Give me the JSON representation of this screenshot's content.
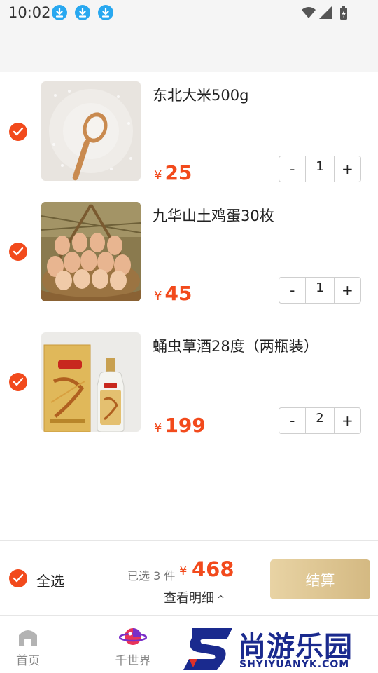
{
  "status_bar": {
    "time": "10:02",
    "notification_icons": [
      "download-icon",
      "download-icon",
      "download-icon"
    ],
    "system_icons": [
      "wifi-icon",
      "signal-icon",
      "battery-icon"
    ]
  },
  "cart": {
    "currency_symbol": "¥",
    "items": [
      {
        "name": "东北大米500g",
        "price": "25",
        "quantity": "1",
        "checked": true,
        "minus_label": "-",
        "plus_label": "+"
      },
      {
        "name": "九华山土鸡蛋30枚",
        "price": "45",
        "quantity": "1",
        "checked": true,
        "minus_label": "-",
        "plus_label": "+"
      },
      {
        "name": "蛹虫草酒28度（两瓶装）",
        "price": "199",
        "quantity": "2",
        "checked": true,
        "minus_label": "-",
        "plus_label": "+"
      }
    ]
  },
  "checkout": {
    "select_all_label": "全选",
    "selected_text": "已选 3 件",
    "currency_symbol": "¥",
    "total": "468",
    "detail_label": "查看明细",
    "detail_arrow": "^",
    "pay_label": "结算",
    "accent_color": "#f24a1c",
    "pay_button_color": "#dcc493"
  },
  "tabbar": {
    "tabs": [
      {
        "label": "首页",
        "icon": "home-icon"
      },
      {
        "label": "千世界",
        "icon": "planet-icon"
      }
    ]
  },
  "watermark": {
    "logo_letter": "S",
    "title": "尚游乐园",
    "subtitle": "SHYIYUANYK.COM"
  }
}
